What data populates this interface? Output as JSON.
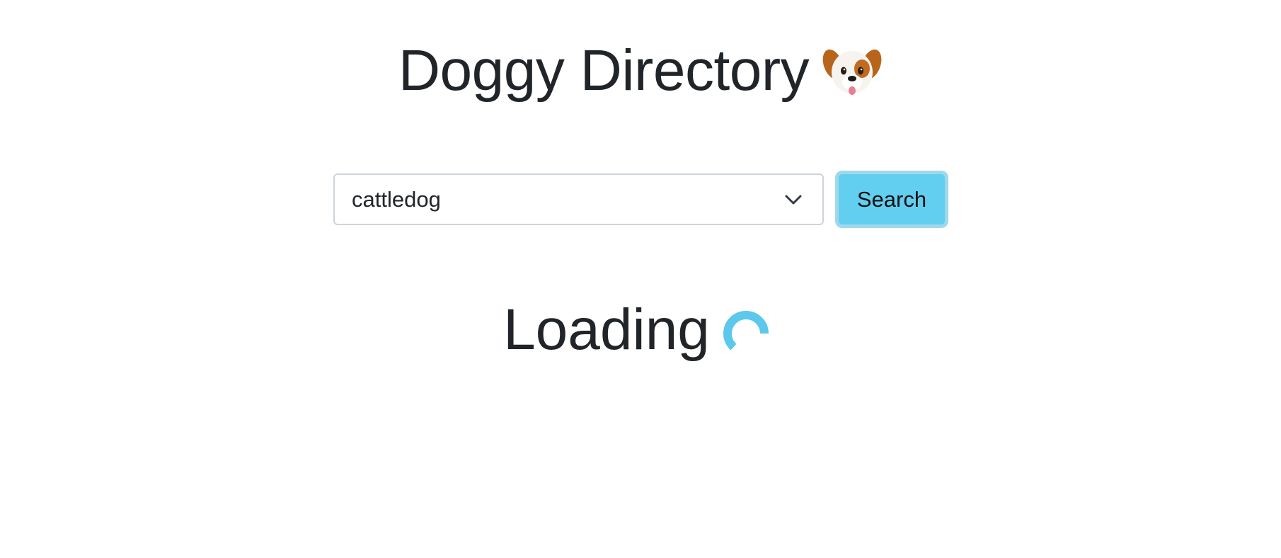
{
  "header": {
    "title": "Doggy Directory",
    "icon": "dog-face-icon"
  },
  "search": {
    "selected_breed": "cattledog",
    "button_label": "Search"
  },
  "status": {
    "loading_text": "Loading",
    "icon": "spinner-icon"
  },
  "colors": {
    "accent": "#62cff0",
    "button_focus_ring": "#9fd8ea",
    "text": "#212529",
    "input_border": "#ced4da",
    "spinner": "#5bc8ec"
  }
}
